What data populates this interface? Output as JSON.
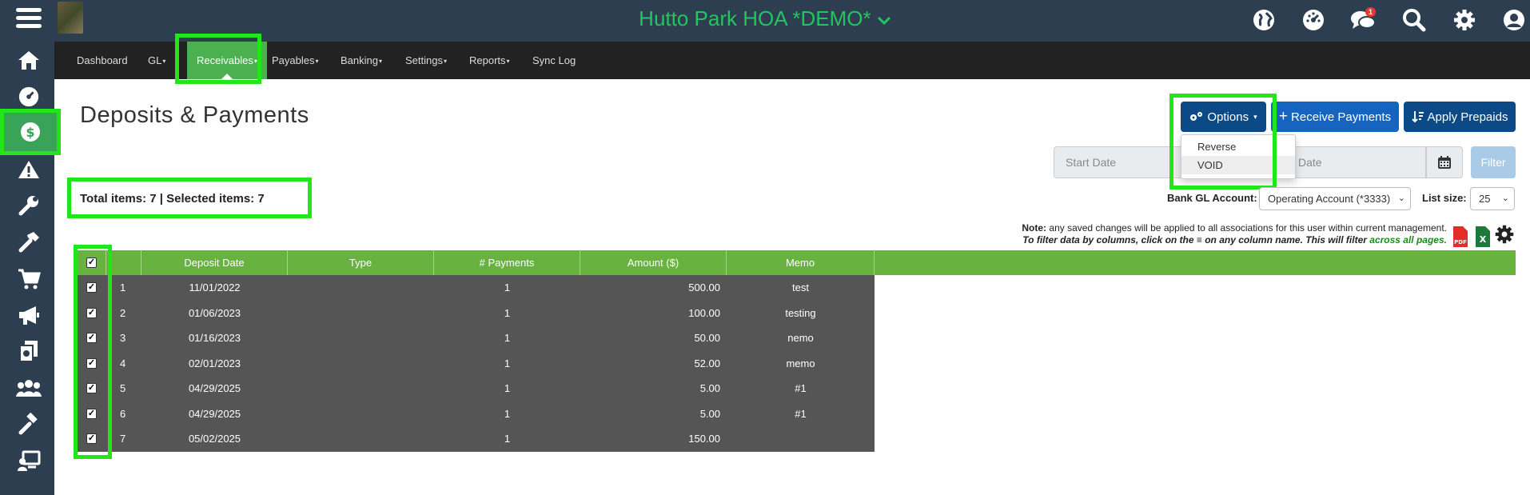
{
  "app": {
    "hoa_title": "Hutto Park HOA *DEMO*",
    "title_chevron": "⌄",
    "notification_count": "1",
    "accent_green": "#22c55e",
    "highlight_green": "#22e51a"
  },
  "topbar_icons": [
    "globe-icon",
    "dashboard-gauge-icon",
    "chat-icon",
    "search-icon",
    "gear-icon",
    "user-icon"
  ],
  "sidebar_icons": [
    "home-icon",
    "gauge-icon",
    "dollar-icon",
    "warning-icon",
    "wrench-icon",
    "hammer-icon",
    "cart-icon",
    "megaphone-icon",
    "documents-icon",
    "people-icon",
    "gavel-icon",
    "presentation-icon"
  ],
  "nav": {
    "dashboard": "Dashboard",
    "gl": "GL",
    "receivables": "Receivables",
    "payables": "Payables",
    "banking": "Banking",
    "settings": "Settings",
    "reports": "Reports",
    "sync_log": "Sync Log",
    "caret": "▾"
  },
  "page": {
    "title": "Deposits & Payments",
    "options_label": "Options",
    "receive_payments_label": "Receive Payments",
    "apply_prepaids_label": "Apply Prepaids",
    "options_menu": [
      "Reverse",
      "VOID"
    ],
    "start_date_placeholder": "Start Date",
    "end_date_placeholder": "Date",
    "filter_label": "Filter",
    "totals_text": "Total items: 7 | Selected items: 7",
    "bank_gl_label": "Bank GL Account:",
    "bank_gl_value": "Operating Account (*3333)",
    "list_size_label": "List size:",
    "list_size_value": "25",
    "note_bold": "Note:",
    "note_text": " any saved changes will be applied to all associations for this user within current management.",
    "filter_hint": "To filter data by columns, click on the ≡ on any column name. This will filter ",
    "filter_hint_green": "across all pages.",
    "pdf_label": "PDF",
    "excel_label": "X"
  },
  "table": {
    "columns": [
      "Deposit Date",
      "Type",
      "# Payments",
      "Amount ($)",
      "Memo"
    ],
    "rows": [
      {
        "n": "1",
        "date": "11/01/2022",
        "type": "",
        "payments": "1",
        "amount": "500.00",
        "memo": "test"
      },
      {
        "n": "2",
        "date": "01/06/2023",
        "type": "",
        "payments": "1",
        "amount": "100.00",
        "memo": "testing"
      },
      {
        "n": "3",
        "date": "01/16/2023",
        "type": "",
        "payments": "1",
        "amount": "50.00",
        "memo": "nemo"
      },
      {
        "n": "4",
        "date": "02/01/2023",
        "type": "",
        "payments": "1",
        "amount": "52.00",
        "memo": "memo"
      },
      {
        "n": "5",
        "date": "04/29/2025",
        "type": "",
        "payments": "1",
        "amount": "5.00",
        "memo": "#1"
      },
      {
        "n": "6",
        "date": "04/29/2025",
        "type": "",
        "payments": "1",
        "amount": "5.00",
        "memo": "#1"
      },
      {
        "n": "7",
        "date": "05/02/2025",
        "type": "",
        "payments": "1",
        "amount": "150.00",
        "memo": ""
      }
    ],
    "check_mark": "✓"
  }
}
